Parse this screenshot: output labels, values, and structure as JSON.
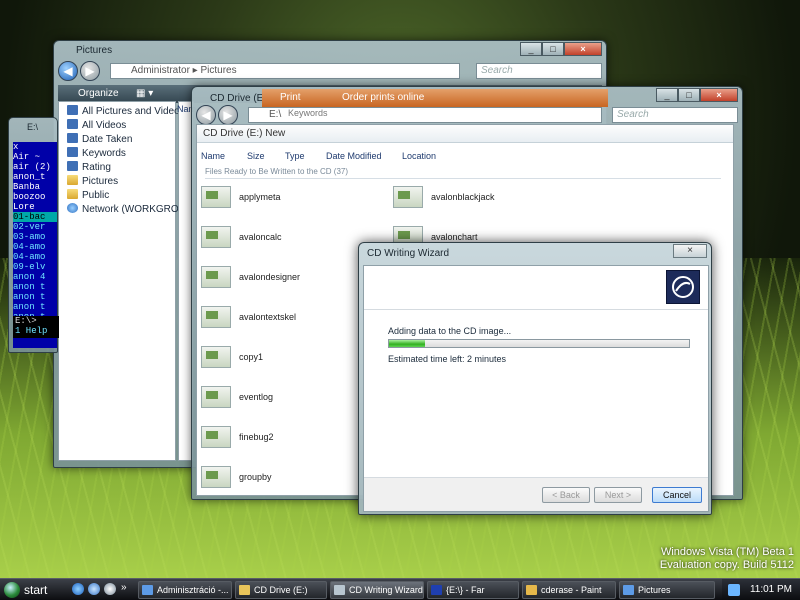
{
  "watermark": {
    "line1": "Windows Vista (TM) Beta 1",
    "line2": "Evaluation copy. Build 5112"
  },
  "pictures_window": {
    "title": "Pictures",
    "address": "Administrator  ▸  Pictures",
    "search_placeholder": "Search",
    "organize": "Organize",
    "column": "Nam",
    "nav": [
      {
        "label": "All Pictures and Videos",
        "icon": "pictures-icon"
      },
      {
        "label": "All Videos",
        "icon": "video-icon"
      },
      {
        "label": "Date Taken",
        "icon": "calendar-icon"
      },
      {
        "label": "Keywords",
        "icon": "tag-icon"
      },
      {
        "label": "Rating",
        "icon": "star-icon"
      },
      {
        "label": "Pictures",
        "icon": "folder-icon"
      },
      {
        "label": "Public",
        "icon": "folder-icon"
      },
      {
        "label": "Network (WORKGROUP",
        "icon": "network-icon"
      }
    ]
  },
  "far_window": {
    "title": "E:\\",
    "lines": [
      "x",
      "Air ~",
      "air (2)",
      "anon_t",
      "Banba",
      "boozoo",
      "Lore",
      "01-bac",
      "02-ver",
      "03-amo",
      "04-amo",
      "04-amo",
      "09-elv",
      "anon 4",
      "anon t",
      "anon t",
      "anon t",
      "anon t"
    ],
    "footer": "ackfro",
    "prompt": "E:\\>",
    "keys": "1 Help"
  },
  "cd_window": {
    "title": "CD Drive (E:)",
    "address": "E:\\",
    "print_label": "Print",
    "order_label": "Order prints online",
    "keywords_label": "Keywords",
    "search_placeholder": "Search",
    "header": "CD Drive (E:) New",
    "columns": [
      "Name",
      "Size",
      "Type",
      "Date Modified",
      "Location"
    ],
    "group": "Files Ready to Be Written to the CD (37)",
    "files_left": [
      "applymeta",
      "avaloncalc",
      "avalondesigner",
      "avalontextskel",
      "copy1",
      "eventlog",
      "finebug2",
      "groupby"
    ],
    "files_right": [
      "avalonblackjack",
      "avalonchart"
    ]
  },
  "wizard": {
    "title": "CD Writing Wizard",
    "message": "Adding data to the CD image...",
    "progress": 0.12,
    "eta": "Estimated time left: 2 minutes",
    "back": "< Back",
    "next": "Next >",
    "cancel": "Cancel",
    "accent": "#33b022"
  },
  "taskbar": {
    "start": "start",
    "tasks": [
      {
        "label": "Adminisztráció -...",
        "icon": "explorer-icon"
      },
      {
        "label": "CD Drive (E:)",
        "icon": "folder-icon"
      },
      {
        "label": "CD Writing Wizard",
        "icon": "cd-icon"
      },
      {
        "label": "{E:\\} - Far",
        "icon": "far-icon"
      },
      {
        "label": "cderase - Paint",
        "icon": "paint-icon"
      },
      {
        "label": "Pictures",
        "icon": "pictures-icon"
      }
    ],
    "clock": "11:01 PM"
  }
}
